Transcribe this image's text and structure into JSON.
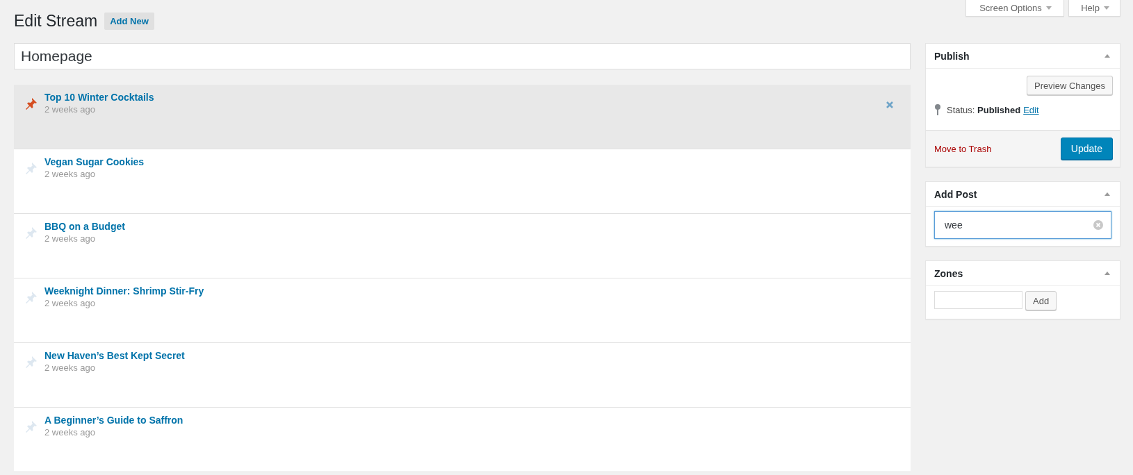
{
  "header": {
    "title": "Edit Stream",
    "add_new": "Add New",
    "screen_options": "Screen Options",
    "help": "Help"
  },
  "stream_title": {
    "value": "Homepage"
  },
  "posts": [
    {
      "title": "Top 10 Winter Cocktails",
      "time": "2 weeks ago",
      "pinned": true
    },
    {
      "title": "Vegan Sugar Cookies",
      "time": "2 weeks ago",
      "pinned": false
    },
    {
      "title": "BBQ on a Budget",
      "time": "2 weeks ago",
      "pinned": false
    },
    {
      "title": "Weeknight Dinner: Shrimp Stir-Fry",
      "time": "2 weeks ago",
      "pinned": false
    },
    {
      "title": "New Haven’s Best Kept Secret",
      "time": "2 weeks ago",
      "pinned": false
    },
    {
      "title": "A Beginner’s Guide to Saffron",
      "time": "2 weeks ago",
      "pinned": false
    }
  ],
  "publish": {
    "title": "Publish",
    "preview": "Preview Changes",
    "status_label": "Status:",
    "status_value": "Published",
    "edit": "Edit",
    "trash": "Move to Trash",
    "update": "Update"
  },
  "add_post": {
    "title": "Add Post",
    "value": "wee"
  },
  "zones": {
    "title": "Zones",
    "add": "Add"
  }
}
